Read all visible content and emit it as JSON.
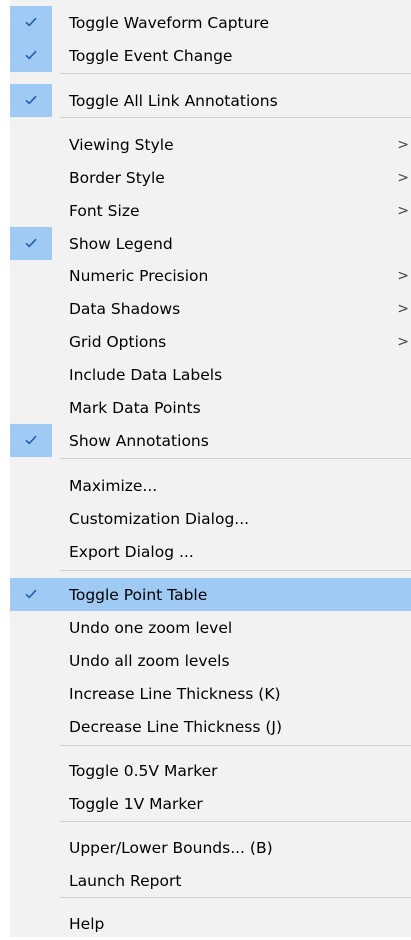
{
  "menu": {
    "items": [
      {
        "label": "Toggle Waveform Capture",
        "checked": true
      },
      {
        "label": "Toggle Event Change",
        "checked": true
      },
      {
        "label": "Toggle All Link Annotations",
        "checked": true
      },
      {
        "label": "Viewing Style",
        "submenu": true,
        "arrow": ">"
      },
      {
        "label": "Border Style",
        "submenu": true,
        "arrow": ">"
      },
      {
        "label": "Font Size",
        "submenu": true,
        "arrow": ">"
      },
      {
        "label": "Show Legend",
        "checked": true
      },
      {
        "label": "Numeric Precision",
        "submenu": true,
        "arrow": ">"
      },
      {
        "label": "Data Shadows",
        "submenu": true,
        "arrow": ">"
      },
      {
        "label": "Grid Options",
        "submenu": true,
        "arrow": ">"
      },
      {
        "label": "Include Data Labels"
      },
      {
        "label": "Mark Data Points"
      },
      {
        "label": "Show Annotations",
        "checked": true
      },
      {
        "label": "Maximize..."
      },
      {
        "label": "Customization Dialog..."
      },
      {
        "label": "Export Dialog ..."
      },
      {
        "label": "Toggle Point Table",
        "checked": true,
        "highlighted": true
      },
      {
        "label": "Undo one zoom level"
      },
      {
        "label": "Undo all zoom levels"
      },
      {
        "label": "Increase Line Thickness (K)"
      },
      {
        "label": "Decrease Line Thickness (J)"
      },
      {
        "label": "Toggle 0.5V Marker"
      },
      {
        "label": "Toggle 1V Marker"
      },
      {
        "label": "Upper/Lower Bounds... (B)"
      },
      {
        "label": "Launch Report"
      },
      {
        "label": "Help"
      }
    ]
  },
  "colors": {
    "menu_bg": "#f2f2f2",
    "check_bg": "#9fcaf3",
    "highlight_bg": "#9fcaf3",
    "check_mark": "#1f5fa8",
    "separator": "#d0d0d0"
  },
  "icons": {
    "check": "checkmark-icon",
    "submenu": "chevron-right-icon"
  }
}
